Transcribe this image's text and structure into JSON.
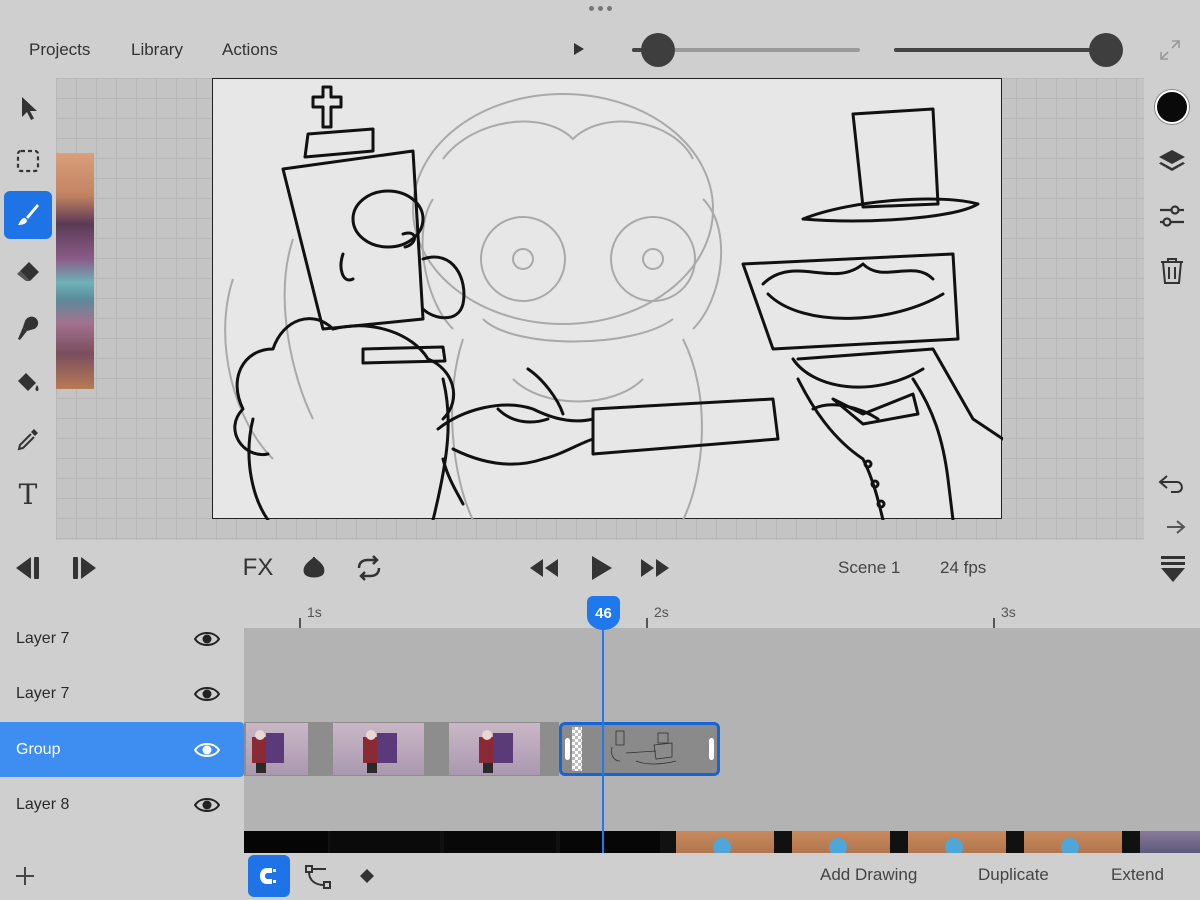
{
  "topbar": {
    "menu": [
      "Projects",
      "Library",
      "Actions"
    ]
  },
  "colors": {
    "accent": "#1e73e6",
    "selected_layer": "#3d8ef0",
    "current_color": "#0a0a0a"
  },
  "tools_left": [
    "select-arrow-icon",
    "selection-marquee-icon",
    "brush-icon",
    "eraser-icon",
    "smudge-icon",
    "paint-bucket-icon",
    "eyedropper-icon",
    "text-icon"
  ],
  "text_tool_glyph": "T",
  "tools_right": [
    "color-swatch",
    "layers-icon",
    "adjustments-icon",
    "trash-icon",
    "undo-icon",
    "redo-icon",
    "collapse-icon"
  ],
  "controls": {
    "fx_label": "FX",
    "scene_label": "Scene 1",
    "fps_label": "24 fps"
  },
  "timeline": {
    "ticks": [
      "1s",
      "2s",
      "3s"
    ],
    "current_frame": "46"
  },
  "layers": [
    {
      "name": "Layer 7",
      "selected": false
    },
    {
      "name": "Layer 7",
      "selected": false
    },
    {
      "name": "Group",
      "selected": true
    },
    {
      "name": "Layer 8",
      "selected": false
    }
  ],
  "bottombar": {
    "add_drawing": "Add Drawing",
    "duplicate": "Duplicate",
    "extend": "Extend"
  }
}
